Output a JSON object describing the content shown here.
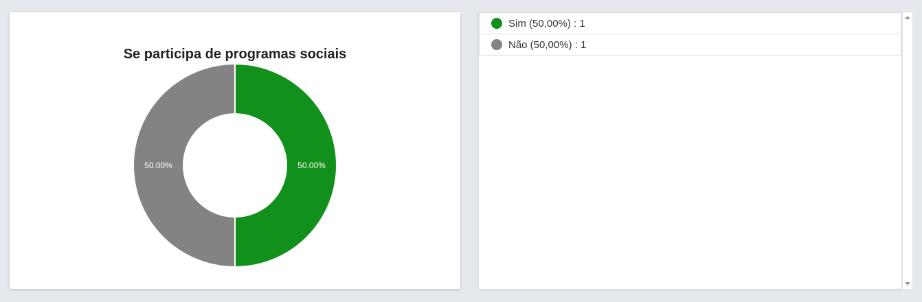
{
  "chart_data": {
    "type": "pie",
    "variant": "donut",
    "title": "Se participa de programas sociais",
    "categories": [
      "Sim",
      "Não"
    ],
    "values": [
      1,
      1
    ],
    "percent_labels": [
      "50.00%",
      "50.00%"
    ],
    "colors": [
      "#11911b",
      "#838383"
    ],
    "legend_placement": "right"
  },
  "legend": {
    "items": [
      {
        "label": "Sim (50,00%) : 1",
        "color": "#11911b"
      },
      {
        "label": "Não (50,00%) : 1",
        "color": "#838383"
      }
    ]
  }
}
